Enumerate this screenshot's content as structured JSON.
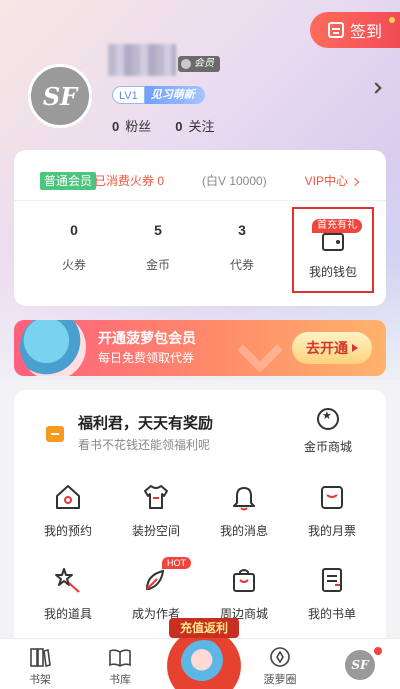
{
  "checkin": {
    "label": "签到"
  },
  "profile": {
    "avatar_text": "SF",
    "member_tag": "会员",
    "level": "LV1",
    "level_title": "见习萌新",
    "fans_count": "0",
    "fans_label": "粉丝",
    "following_count": "0",
    "following_label": "关注"
  },
  "vip": {
    "badge": "普通会员",
    "consumed": "已消费火券 0",
    "note": "(白V 10000)",
    "center_link": "VIP中心"
  },
  "assets": [
    {
      "value": "0",
      "label": "火券"
    },
    {
      "value": "5",
      "label": "金币"
    },
    {
      "value": "3",
      "label": "代券"
    }
  ],
  "wallet": {
    "badge": "首充有礼",
    "label": "我的钱包"
  },
  "banner": {
    "title": "开通菠萝包会员",
    "subtitle": "每日免费领取代券",
    "button": "去开通"
  },
  "welfare": {
    "title": "福利君，天天有奖励",
    "subtitle": "看书不花钱还能领福利呢",
    "coin_shop": "金币商城"
  },
  "grid": [
    {
      "label": "我的预约",
      "icon": "home-icon"
    },
    {
      "label": "装扮空间",
      "icon": "shirt-icon"
    },
    {
      "label": "我的消息",
      "icon": "bell-icon"
    },
    {
      "label": "我的月票",
      "icon": "ticket-icon"
    },
    {
      "label": "我的道具",
      "icon": "wand-icon"
    },
    {
      "label": "成为作者",
      "icon": "feather-icon",
      "badge": "HOT"
    },
    {
      "label": "周边商城",
      "icon": "bag-icon"
    },
    {
      "label": "我的书单",
      "icon": "booklist-icon"
    }
  ],
  "tabbar": {
    "tabs": [
      {
        "label": "书架",
        "icon": "bookshelf-icon"
      },
      {
        "label": "书库",
        "icon": "library-icon"
      },
      {
        "label": "",
        "icon": "center-art"
      },
      {
        "label": "菠萝圈",
        "icon": "circle-icon"
      },
      {
        "label": "",
        "icon": "me-avatar"
      }
    ],
    "center_art_text": "充值返利",
    "me_avatar_text": "SF"
  },
  "colors": {
    "accent": "#f0543d",
    "vip_green": "#4cc57e",
    "level_blue": "#5d8de4"
  }
}
